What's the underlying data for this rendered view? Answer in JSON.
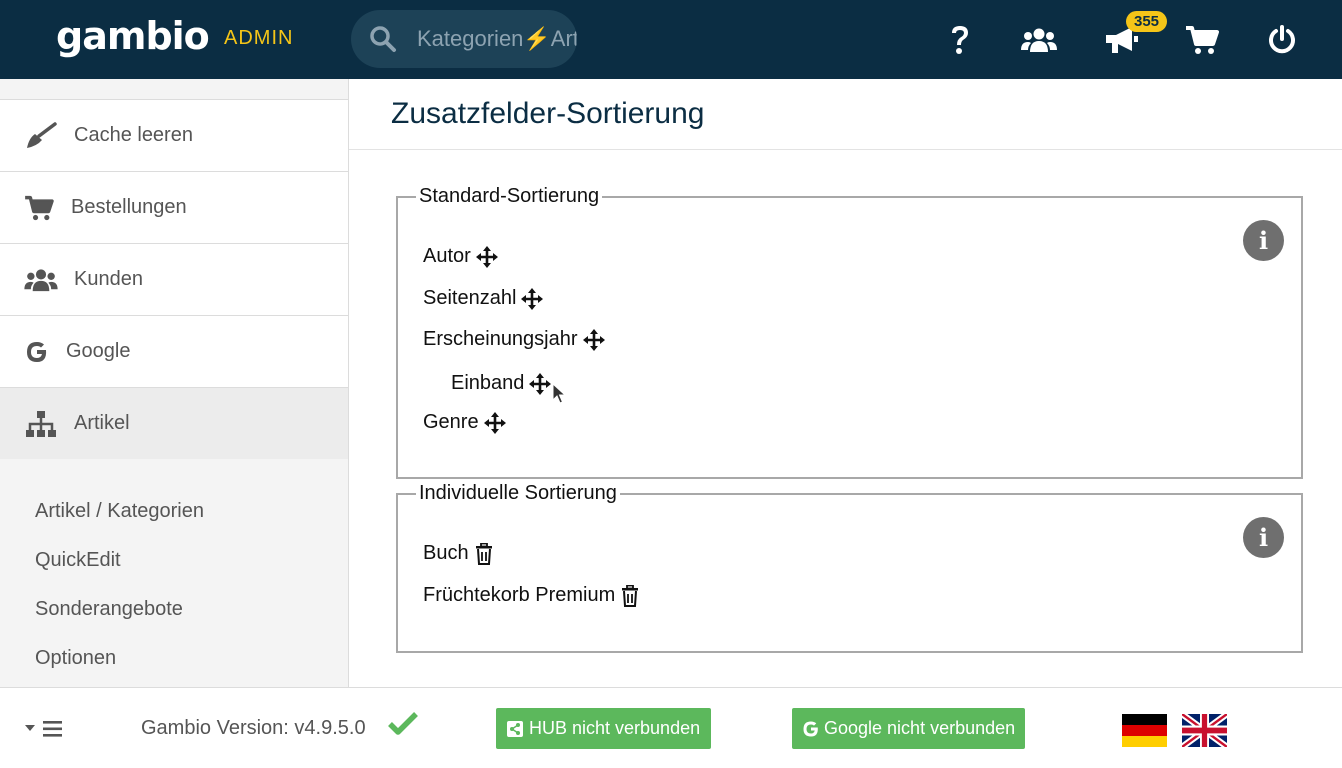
{
  "header": {
    "logo": "gambio",
    "admin_label": "ADMIN",
    "search_placeholder": "Kategorien⚡Artikel",
    "notification_count": "355",
    "icons": [
      "help-icon",
      "users-icon",
      "megaphone-icon",
      "cart-icon",
      "power-icon"
    ],
    "accent_color": "#f5c518",
    "bar_color": "#0b2d43"
  },
  "sidebar": {
    "items": [
      {
        "label": "Cache leeren",
        "icon": "broom-icon"
      },
      {
        "label": "Bestellungen",
        "icon": "cart-icon"
      },
      {
        "label": "Kunden",
        "icon": "users-icon"
      },
      {
        "label": "Google",
        "icon": "google-icon"
      },
      {
        "label": "Artikel",
        "icon": "sitemap-icon",
        "active": true
      }
    ],
    "subitems": [
      "Artikel / Kategorien",
      "QuickEdit",
      "Sonderangebote",
      "Optionen"
    ]
  },
  "main": {
    "title": "Zusatzfelder-Sortierung",
    "standard": {
      "legend": "Standard-Sortierung",
      "fields": [
        "Autor",
        "Seitenzahl",
        "Erscheinungsjahr",
        "Einband",
        "Genre"
      ]
    },
    "individual": {
      "legend": "Individuelle Sortierung",
      "fields": [
        "Buch",
        "Früchtekorb Premium"
      ]
    }
  },
  "footer": {
    "version": "Gambio Version: v4.9.5.0",
    "hub_button": "HUB nicht verbunden",
    "google_button": "Google nicht verbunden",
    "button_color": "#5cb85c",
    "languages": [
      "de",
      "en"
    ]
  }
}
